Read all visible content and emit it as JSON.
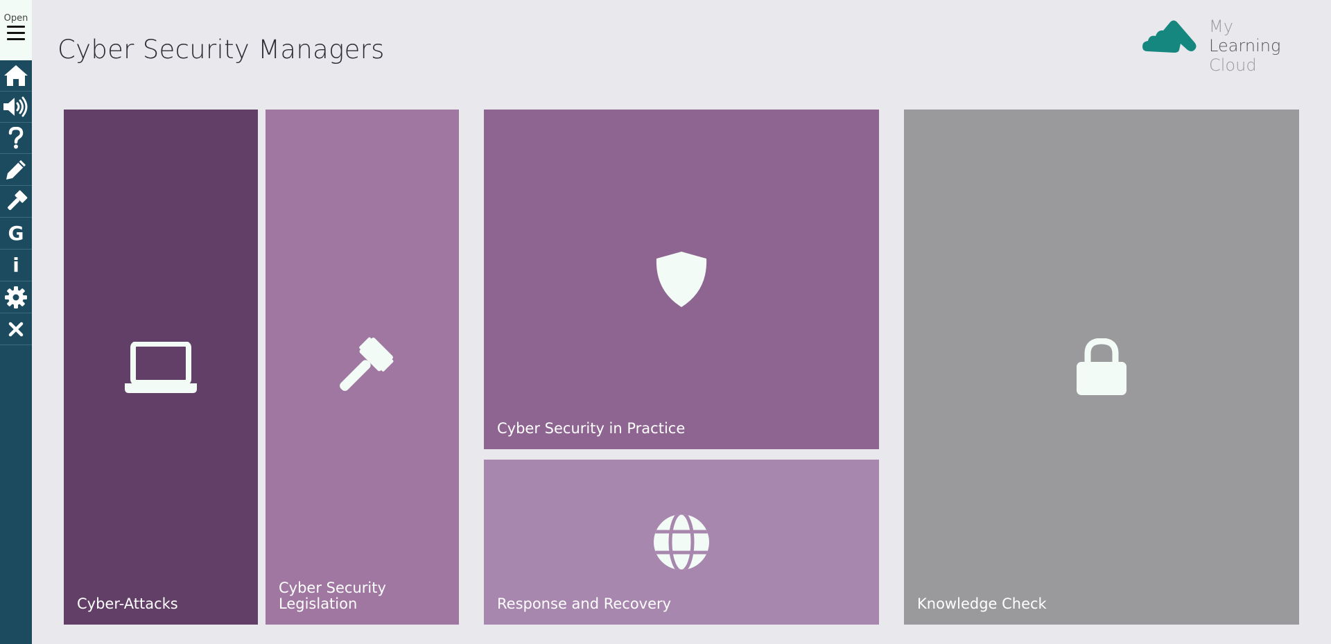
{
  "app": {
    "title": "Cyber Security Managers"
  },
  "sidebar": {
    "open_label": "Open",
    "items": [
      {
        "name": "home",
        "icon": "home-icon"
      },
      {
        "name": "audio",
        "icon": "volume-icon"
      },
      {
        "name": "help",
        "icon": "question-icon"
      },
      {
        "name": "notes",
        "icon": "pencil-icon"
      },
      {
        "name": "tools",
        "icon": "gavel-icon"
      },
      {
        "name": "glossary",
        "icon": "g-icon",
        "glyph": "G"
      },
      {
        "name": "info",
        "icon": "info-icon",
        "glyph": "i"
      },
      {
        "name": "settings",
        "icon": "gear-icon"
      },
      {
        "name": "close",
        "icon": "close-icon"
      }
    ]
  },
  "logo": {
    "text_light": "My",
    "text_strong": "Learning",
    "text_line2": "Cloud",
    "color": "#16877e"
  },
  "tiles": [
    {
      "label": "Cyber-Attacks",
      "icon": "laptop-icon",
      "color": "#613f66"
    },
    {
      "label": "Cyber Security Legislation",
      "icon": "gavel-icon",
      "color": "#9f77a1"
    },
    {
      "label": "Cyber Security in Practice",
      "icon": "shield-icon",
      "color": "#8e6591"
    },
    {
      "label": "Response and Recovery",
      "icon": "globe-icon",
      "color": "#a887ae"
    },
    {
      "label": "Knowledge Check",
      "icon": "lock-icon",
      "color": "#9a999b"
    }
  ],
  "colors": {
    "background": "#e9e8ed",
    "sidebar": "#1c4b5f",
    "icon_fill": "#f2fbf6"
  }
}
